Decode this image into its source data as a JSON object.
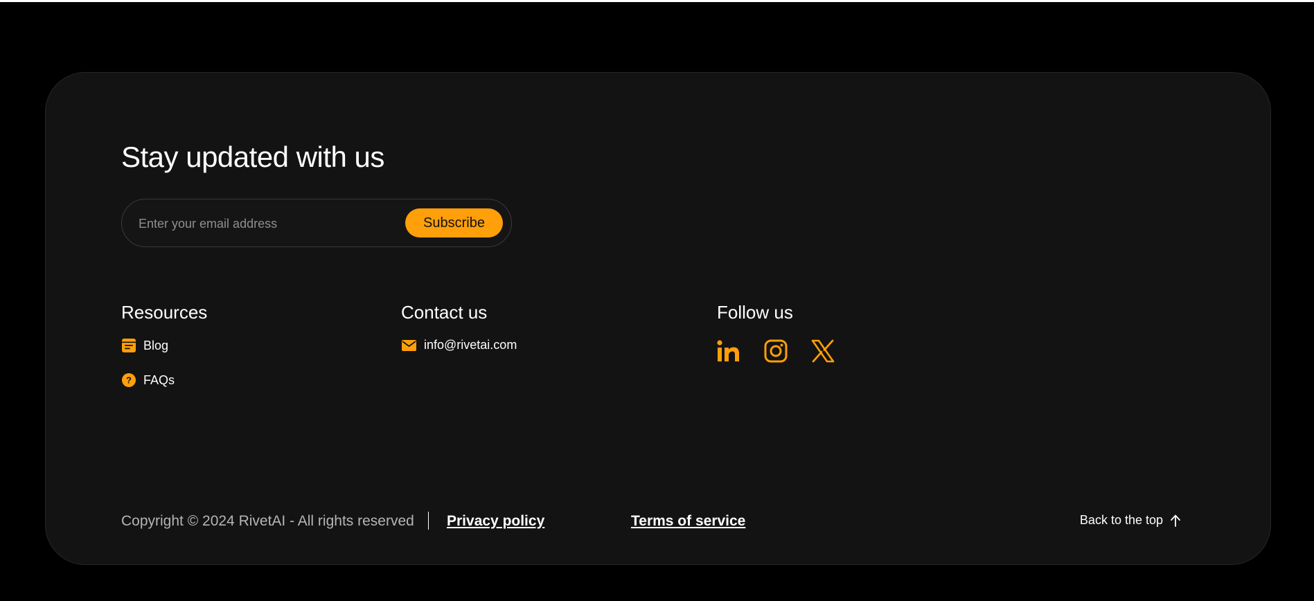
{
  "newsletter": {
    "heading": "Stay updated with us",
    "email_placeholder": "Enter your email address",
    "subscribe_label": "Subscribe"
  },
  "resources": {
    "heading": "Resources",
    "items": [
      {
        "label": "Blog",
        "icon": "blog-icon"
      },
      {
        "label": "FAQs",
        "icon": "question-icon"
      }
    ]
  },
  "contact": {
    "heading": "Contact us",
    "email": "info@rivetai.com",
    "icon": "mail-icon"
  },
  "follow": {
    "heading": "Follow us",
    "networks": [
      "linkedin-icon",
      "instagram-icon",
      "x-icon"
    ]
  },
  "bottom": {
    "copyright": "Copyright © 2024 RivetAI - All rights reserved",
    "privacy": "Privacy policy",
    "terms": "Terms of service",
    "back_to_top": "Back to the top"
  },
  "colors": {
    "accent": "#ff9f0a",
    "card_bg": "#131313",
    "page_bg": "#000000"
  }
}
